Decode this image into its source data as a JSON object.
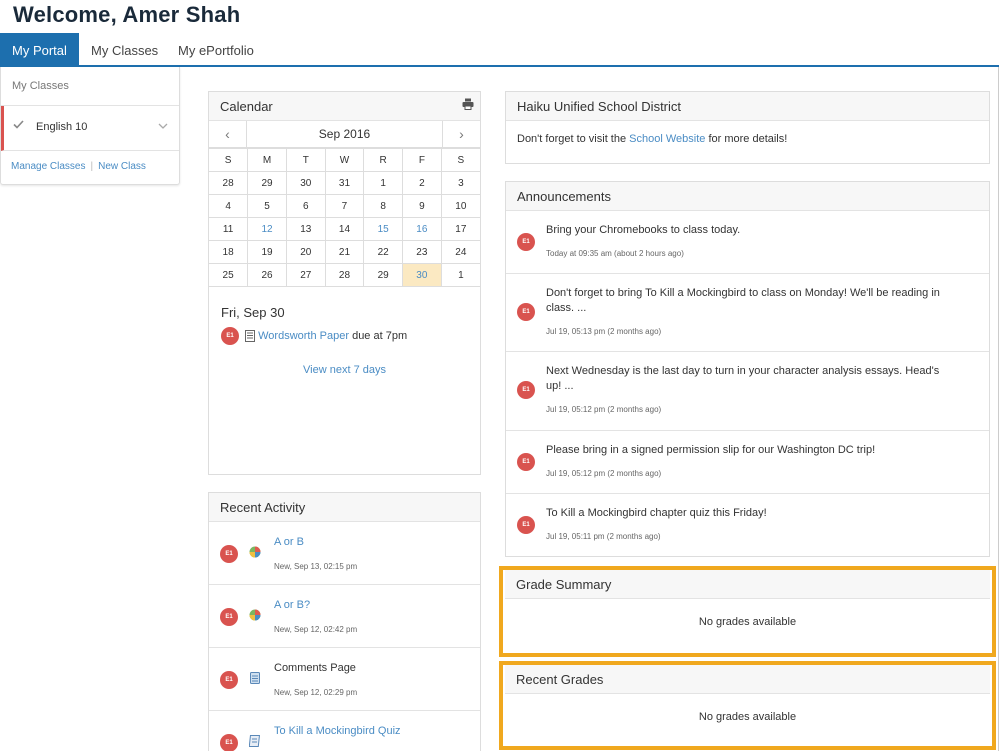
{
  "header": {
    "title": "Welcome, Amer Shah"
  },
  "tabs": [
    {
      "label": "My Portal",
      "active": true
    },
    {
      "label": "My Classes",
      "active": false
    },
    {
      "label": "My ePortfolio",
      "active": false
    }
  ],
  "sidebar": {
    "heading": "My Classes",
    "items": [
      {
        "label": "English 10",
        "icon": "check-icon"
      }
    ],
    "links": {
      "manage": "Manage Classes",
      "separator": "|",
      "new": "New Class"
    }
  },
  "calendar": {
    "title": "Calendar",
    "month": "Sep 2016",
    "prev": "‹",
    "next": "›",
    "weekdays": [
      "S",
      "M",
      "T",
      "W",
      "R",
      "F",
      "S"
    ],
    "weeks": [
      [
        "28",
        "29",
        "30",
        "31",
        "1",
        "2",
        "3"
      ],
      [
        "4",
        "5",
        "6",
        "7",
        "8",
        "9",
        "10"
      ],
      [
        "11",
        "12",
        "13",
        "14",
        "15",
        "16",
        "17"
      ],
      [
        "18",
        "19",
        "20",
        "21",
        "22",
        "23",
        "24"
      ],
      [
        "25",
        "26",
        "27",
        "28",
        "29",
        "30",
        "1"
      ]
    ],
    "link_days": [
      "12",
      "15",
      "16"
    ],
    "today": "30",
    "selected_day_heading": "Fri, Sep 30",
    "event": {
      "badge": "E1",
      "title": "Wordsworth Paper",
      "suffix": " due at 7pm"
    },
    "view_next": "View next 7 days"
  },
  "district": {
    "title": "Haiku Unified School District",
    "text_before": "Don't forget to visit the ",
    "link": "School Website",
    "text_after": " for more details!"
  },
  "announcements": {
    "title": "Announcements",
    "items": [
      {
        "badge": "E1",
        "text": "Bring your Chromebooks to class today.",
        "time": "Today at 09:35 am (about 2 hours ago)"
      },
      {
        "badge": "E1",
        "text": "Don't forget to bring To Kill a Mockingbird to class on Monday! We'll be reading in class. ...",
        "time": "Jul 19, 05:13 pm (2 months ago)"
      },
      {
        "badge": "E1",
        "text": "Next Wednesday is the last day to turn in your character analysis essays. Head's up! ...",
        "time": "Jul 19, 05:12 pm (2 months ago)"
      },
      {
        "badge": "E1",
        "text": "Please bring in a signed permission slip for our Washington DC trip!",
        "time": "Jul 19, 05:12 pm (2 months ago)"
      },
      {
        "badge": "E1",
        "text": "To Kill a Mockingbird chapter quiz this Friday!",
        "time": "Jul 19, 05:11 pm (2 months ago)"
      }
    ]
  },
  "recent_activity": {
    "title": "Recent Activity",
    "items": [
      {
        "badge": "E1",
        "icon": "poll-icon",
        "title": "A or B",
        "is_link": true,
        "time": "New, Sep 13, 02:15 pm"
      },
      {
        "badge": "E1",
        "icon": "poll-icon",
        "title": "A or B?",
        "is_link": true,
        "time": "New, Sep 12, 02:42 pm"
      },
      {
        "badge": "E1",
        "icon": "page-icon",
        "title": "Comments Page",
        "is_link": false,
        "time": "New, Sep 12, 02:29 pm"
      },
      {
        "badge": "E1",
        "icon": "quiz-icon",
        "title": "To Kill a Mockingbird Quiz",
        "is_link": true,
        "time": ""
      }
    ]
  },
  "grade_summary": {
    "title": "Grade Summary",
    "empty": "No grades available"
  },
  "recent_grades": {
    "title": "Recent Grades",
    "empty": "No grades available"
  },
  "colors": {
    "accent": "#1d6fae",
    "badge": "#d9534f",
    "link": "#4a8cc4",
    "highlight": "#f0a81e",
    "today": "#fbe9c2"
  }
}
